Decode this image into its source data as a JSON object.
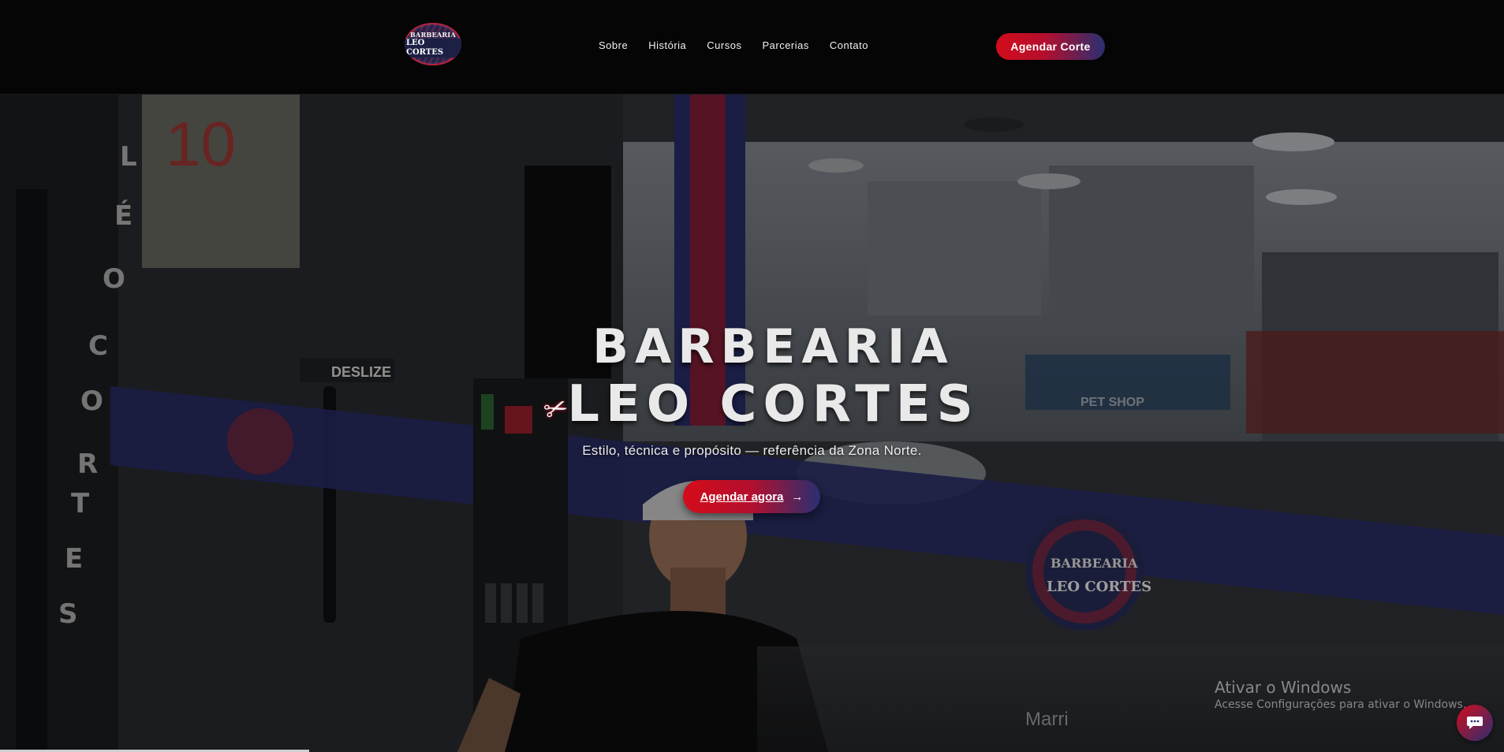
{
  "header": {
    "logo": {
      "line1": "BARBEARIA",
      "line2": "LEO CORTES"
    },
    "nav": [
      {
        "label": "Sobre"
      },
      {
        "label": "História"
      },
      {
        "label": "Cursos"
      },
      {
        "label": "Parcerias"
      },
      {
        "label": "Contato"
      }
    ],
    "cta_label": "Agendar Corte"
  },
  "hero": {
    "title_line1": "BARBEARIA",
    "title_line2": "LEO CORTES",
    "tagline": "Estilo, técnica e propósito — referência da Zona Norte.",
    "cta_label": "Agendar agora",
    "cta_icon": "arrow-right-icon",
    "background_icon": "barbershop-photo",
    "storefront_texts": {
      "door_sign": "DESLIZE",
      "vertical_letters": "LÉO CORTES",
      "jersey_number": "10",
      "shop_sign": "PET SHOP",
      "corner_sign": "Marri"
    }
  },
  "overlay": {
    "watermark_title": "Ativar o Windows",
    "watermark_subtitle": "Acesse Configurações para ativar o Windows.",
    "chat_icon": "chat-bubble-icon"
  },
  "colors": {
    "accent_red": "#d30c1b",
    "accent_blue": "#2a2f72",
    "header_bg": "#050506"
  }
}
